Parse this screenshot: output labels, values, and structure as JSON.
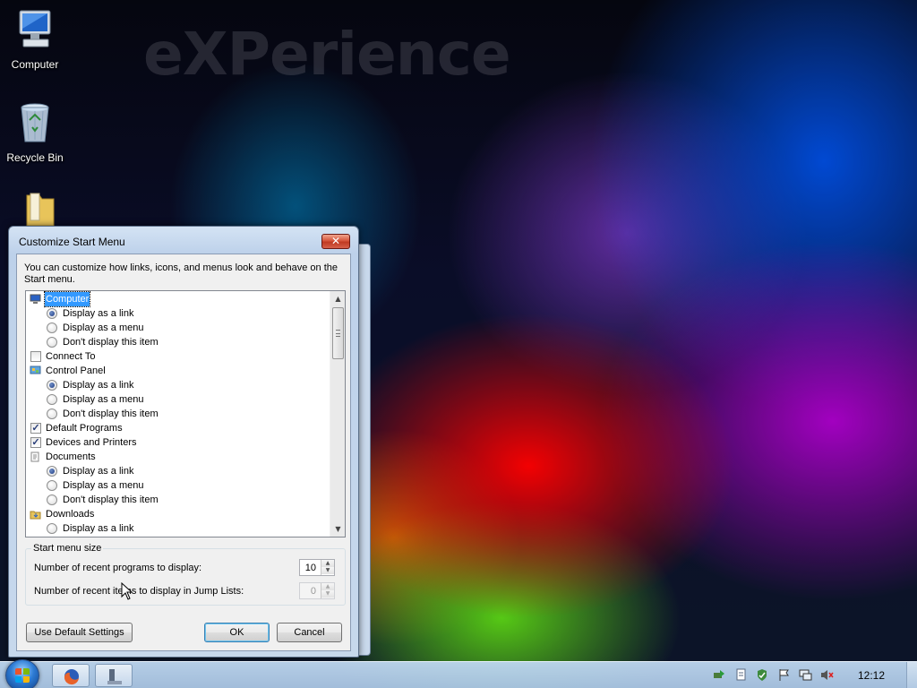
{
  "desktop": {
    "watermark": "eXPerience",
    "icons": [
      {
        "label": "Computer",
        "icon": "computer-icon"
      },
      {
        "label": "Recycle Bin",
        "icon": "recycle-bin-icon"
      },
      {
        "label": "",
        "icon": "folder-icon"
      }
    ]
  },
  "dialog": {
    "title": "Customize Start Menu",
    "close_label": "✕",
    "intro": "You can customize how links, icons, and menus look and behave on the Start menu.",
    "items": [
      {
        "kind": "header",
        "icon": "computer-icon",
        "label": "Computer",
        "selected": true
      },
      {
        "kind": "radio",
        "label": "Display as a link",
        "checked": true
      },
      {
        "kind": "radio",
        "label": "Display as a menu",
        "checked": false
      },
      {
        "kind": "radio",
        "label": "Don't display this item",
        "checked": false
      },
      {
        "kind": "checkbox",
        "label": "Connect To",
        "checked": false
      },
      {
        "kind": "header",
        "icon": "control-panel-icon",
        "label": "Control Panel"
      },
      {
        "kind": "radio",
        "label": "Display as a link",
        "checked": true
      },
      {
        "kind": "radio",
        "label": "Display as a menu",
        "checked": false
      },
      {
        "kind": "radio",
        "label": "Don't display this item",
        "checked": false
      },
      {
        "kind": "checkbox",
        "label": "Default Programs",
        "checked": true
      },
      {
        "kind": "checkbox",
        "label": "Devices and Printers",
        "checked": true
      },
      {
        "kind": "header",
        "icon": "documents-icon",
        "label": "Documents"
      },
      {
        "kind": "radio",
        "label": "Display as a link",
        "checked": true
      },
      {
        "kind": "radio",
        "label": "Display as a menu",
        "checked": false
      },
      {
        "kind": "radio",
        "label": "Don't display this item",
        "checked": false
      },
      {
        "kind": "header",
        "icon": "downloads-icon",
        "label": "Downloads"
      },
      {
        "kind": "radio",
        "label": "Display as a link",
        "checked": false
      }
    ],
    "size_group": {
      "legend": "Start menu size",
      "recent_programs_label": "Number of recent programs to display:",
      "recent_programs_value": "10",
      "jump_list_label": "Number of recent items to display in Jump Lists:",
      "jump_list_value": "0"
    },
    "buttons": {
      "defaults": "Use Default Settings",
      "ok": "OK",
      "cancel": "Cancel"
    }
  },
  "taskbar": {
    "clock": "12:12",
    "pinned": [
      "firefox-icon",
      "app-icon"
    ],
    "tray_icons": [
      "network-icon",
      "document-icon",
      "security-icon",
      "action-center-flag-icon",
      "display-icon",
      "volume-muted-icon"
    ]
  },
  "colors": {
    "selection": "#3399ff",
    "window_frame": "#bdd1ea"
  }
}
